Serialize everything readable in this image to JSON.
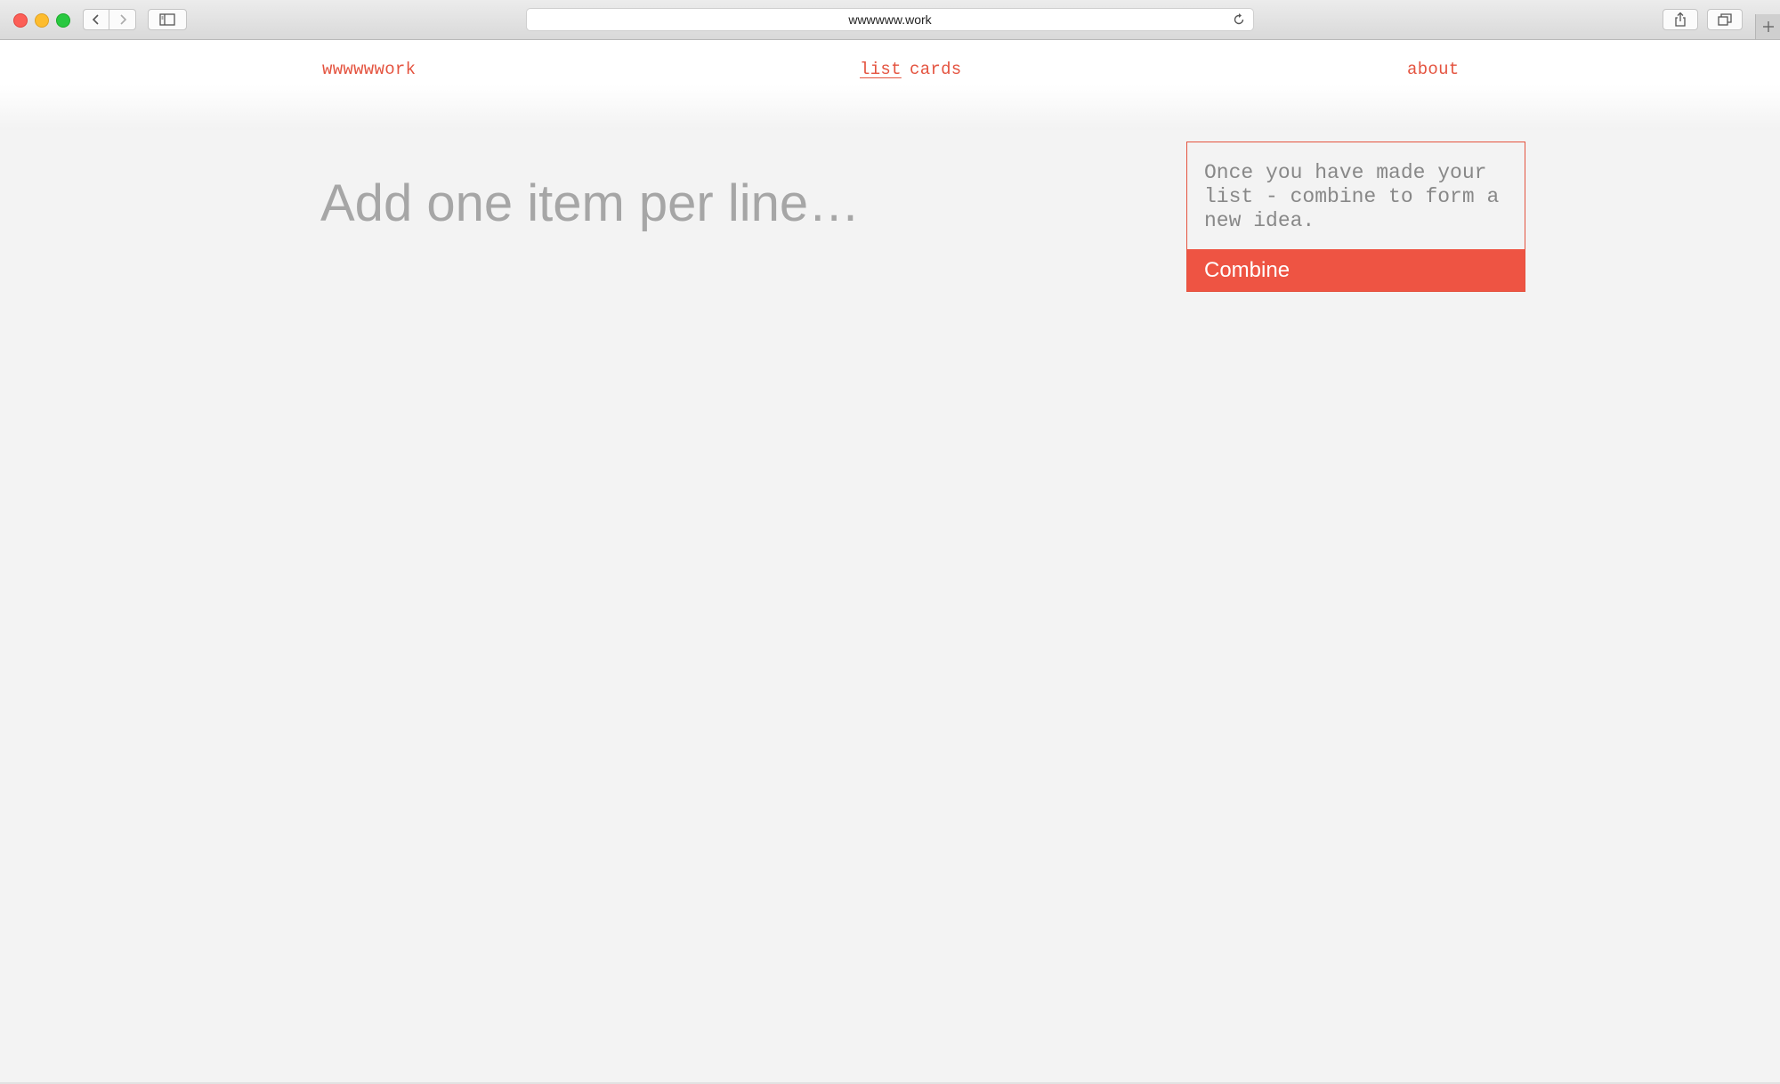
{
  "browser": {
    "url": "wwwwww.work"
  },
  "site": {
    "logo": "wwwwwwork",
    "nav": {
      "list": "list",
      "cards": "cards",
      "about": "about"
    }
  },
  "main": {
    "input_placeholder": "Add one item per line…"
  },
  "combine": {
    "help_text": "Once you have made your list - combine to form a new idea.",
    "button_label": "Combine"
  },
  "colors": {
    "accent": "#ee5443",
    "link": "#e4533f",
    "background": "#f3f3f3",
    "placeholder": "#a6a6a6"
  },
  "icons": {
    "back": "chevron-left-icon",
    "forward": "chevron-right-icon",
    "sidebar": "sidebar-icon",
    "reload": "reload-icon",
    "share": "share-icon",
    "tabs": "tabs-icon",
    "add_tab": "plus-icon"
  }
}
